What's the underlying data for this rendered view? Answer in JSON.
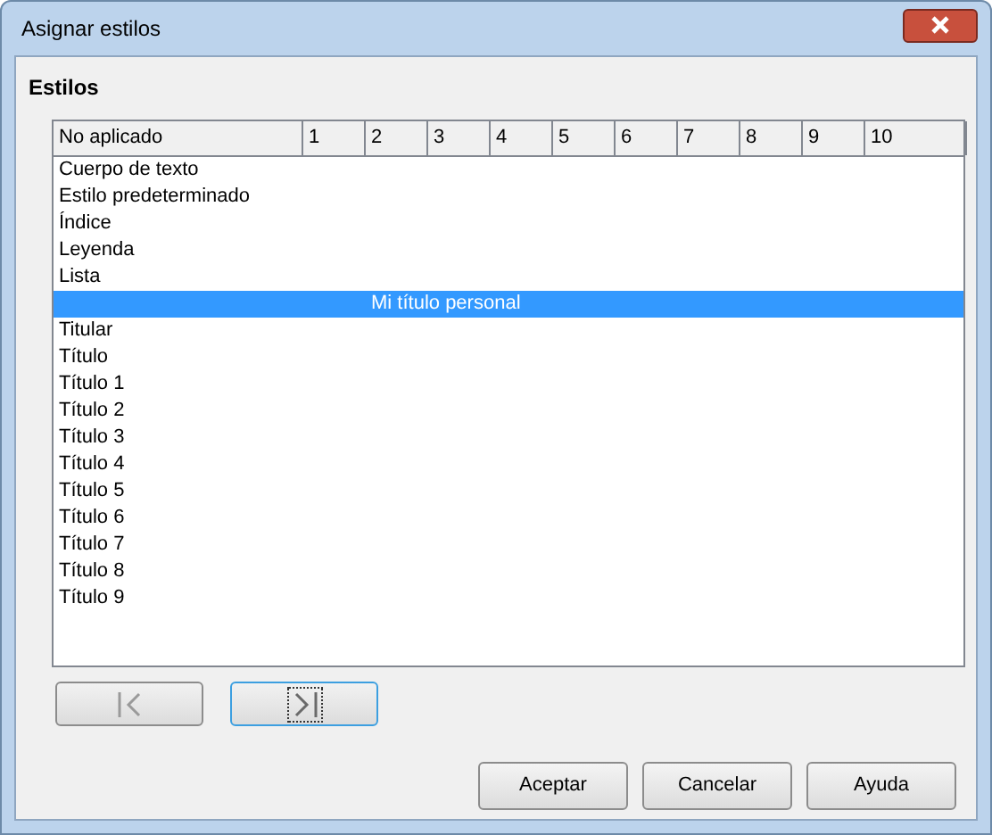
{
  "window": {
    "title": "Asignar estilos"
  },
  "section": {
    "title": "Estilos"
  },
  "table": {
    "columns": [
      "No aplicado",
      "1",
      "2",
      "3",
      "4",
      "5",
      "6",
      "7",
      "8",
      "9",
      "10"
    ],
    "rows": [
      {
        "label": "Cuerpo de texto",
        "kind": "unassigned",
        "selected": false
      },
      {
        "label": "Estilo predeterminado",
        "kind": "unassigned",
        "selected": false
      },
      {
        "label": "Índice",
        "kind": "unassigned",
        "selected": false
      },
      {
        "label": "Leyenda",
        "kind": "unassigned",
        "selected": false
      },
      {
        "label": "Lista",
        "kind": "unassigned",
        "selected": false
      },
      {
        "label": "Mi título personal",
        "kind": "level2",
        "selected": true
      },
      {
        "label": "Titular",
        "kind": "unassigned",
        "selected": false
      },
      {
        "label": "Título",
        "kind": "unassigned",
        "selected": false
      },
      {
        "label": "Título 1",
        "kind": "unassigned",
        "selected": false
      },
      {
        "label": "Título 2",
        "kind": "unassigned",
        "selected": false
      },
      {
        "label": "Título 3",
        "kind": "unassigned",
        "selected": false
      },
      {
        "label": "Título 4",
        "kind": "unassigned",
        "selected": false
      },
      {
        "label": "Título 5",
        "kind": "unassigned",
        "selected": false
      },
      {
        "label": "Título 6",
        "kind": "unassigned",
        "selected": false
      },
      {
        "label": "Título 7",
        "kind": "unassigned",
        "selected": false
      },
      {
        "label": "Título 8",
        "kind": "unassigned",
        "selected": false
      },
      {
        "label": "Título 9",
        "kind": "unassigned",
        "selected": false
      }
    ]
  },
  "move_buttons": [
    {
      "kind": "left",
      "disabled": true,
      "focused": false
    },
    {
      "kind": "right",
      "disabled": false,
      "focused": true
    }
  ],
  "buttons": [
    "Aceptar",
    "Cancelar",
    "Ayuda"
  ]
}
